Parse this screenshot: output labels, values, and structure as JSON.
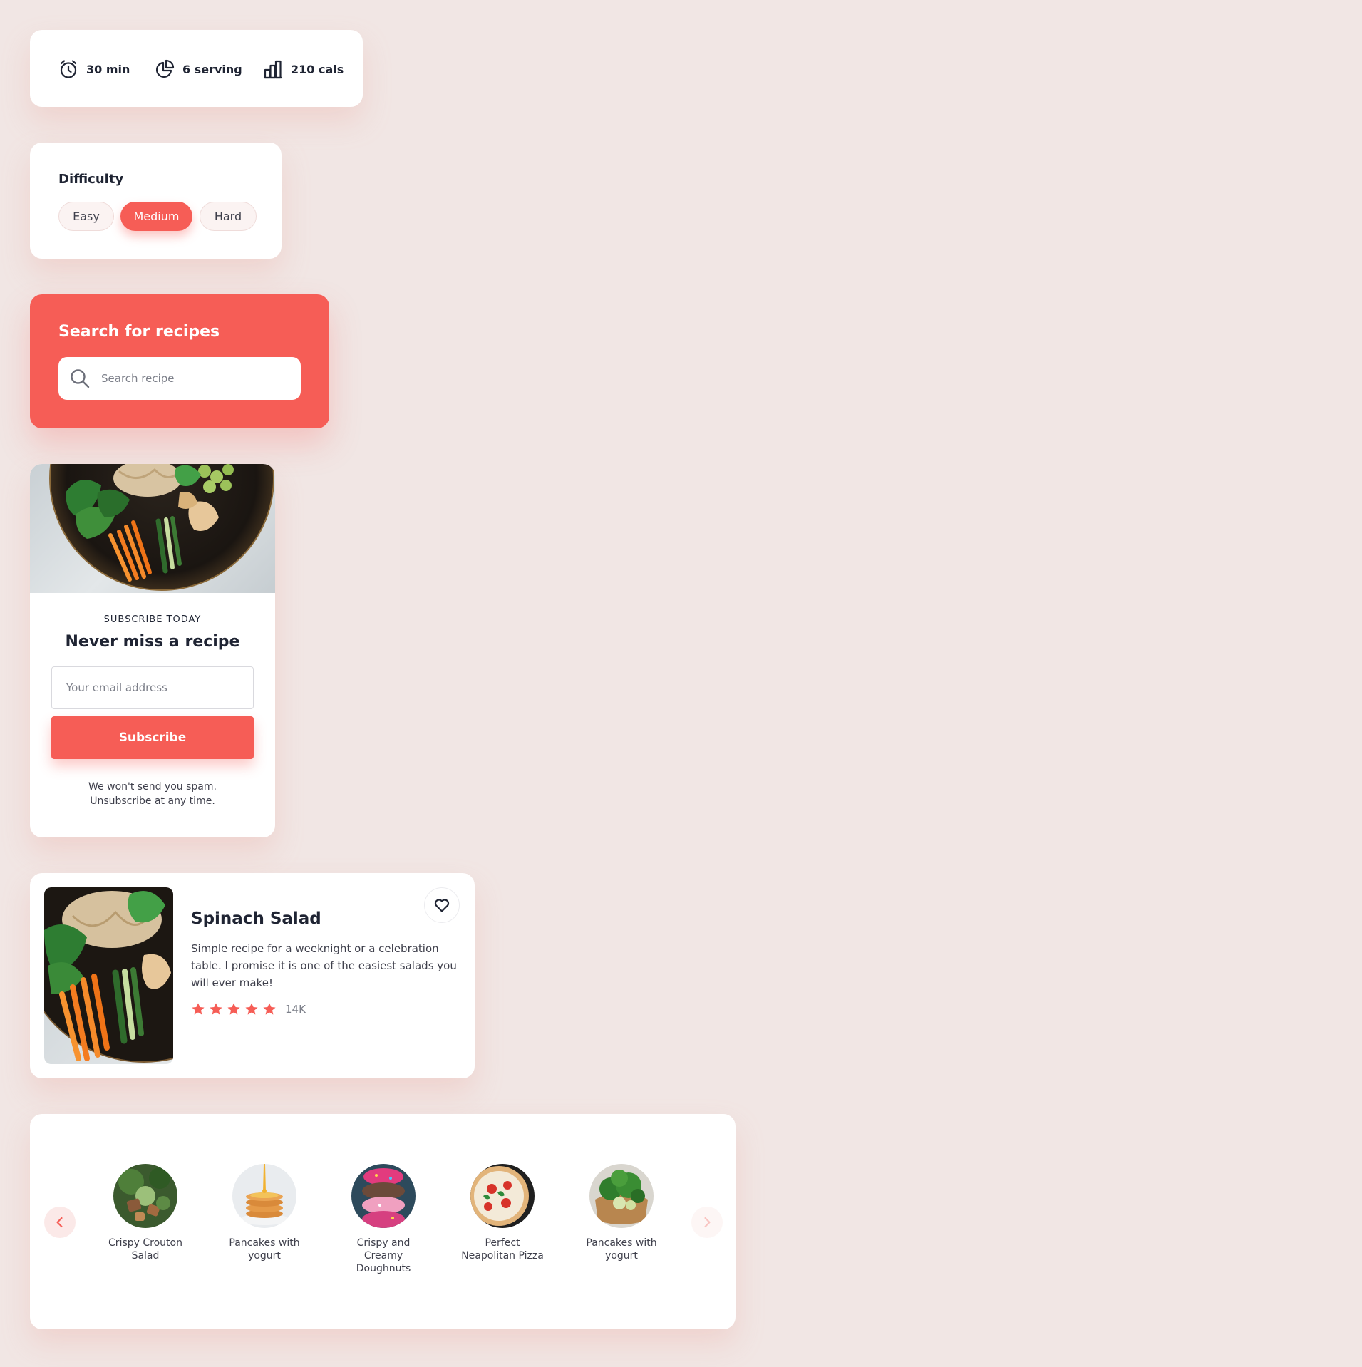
{
  "stats": {
    "time": {
      "icon": "alarm-clock-icon",
      "label": "30 min"
    },
    "servings": {
      "icon": "pie-chart-icon",
      "label": "6 serving"
    },
    "calories": {
      "icon": "bar-chart-icon",
      "label": "210 cals"
    }
  },
  "difficulty": {
    "title": "Difficulty",
    "options": [
      "Easy",
      "Medium",
      "Hard"
    ],
    "selected": "Medium"
  },
  "search": {
    "title": "Search for recipes",
    "placeholder": "Search recipe",
    "value": ""
  },
  "subscribe": {
    "eyebrow": "SUBSCRIBE TODAY",
    "title": "Never miss a recipe",
    "email_placeholder": "Your email address",
    "button": "Subscribe",
    "note_line1": "We won't send you spam.",
    "note_line2": "Unsubscribe at any time."
  },
  "recipe": {
    "title": "Spinach Salad",
    "description": "Simple recipe for a weeknight or a celebration table. I promise it is one of the easiest salads you will ever make!",
    "stars": 5,
    "rating_count": "14K",
    "favorite": false
  },
  "carousel": {
    "items": [
      {
        "label": "Crispy Crouton Salad"
      },
      {
        "label": "Pancakes with yogurt"
      },
      {
        "label": "Crispy and Creamy Doughnuts"
      },
      {
        "label": "Perfect Neapolitan Pizza"
      },
      {
        "label": "Pancakes with yogurt"
      }
    ]
  },
  "colors": {
    "background": "#f1e6e4",
    "accent": "#f65d56",
    "text": "#1f2433",
    "muted": "#7c7f89"
  }
}
